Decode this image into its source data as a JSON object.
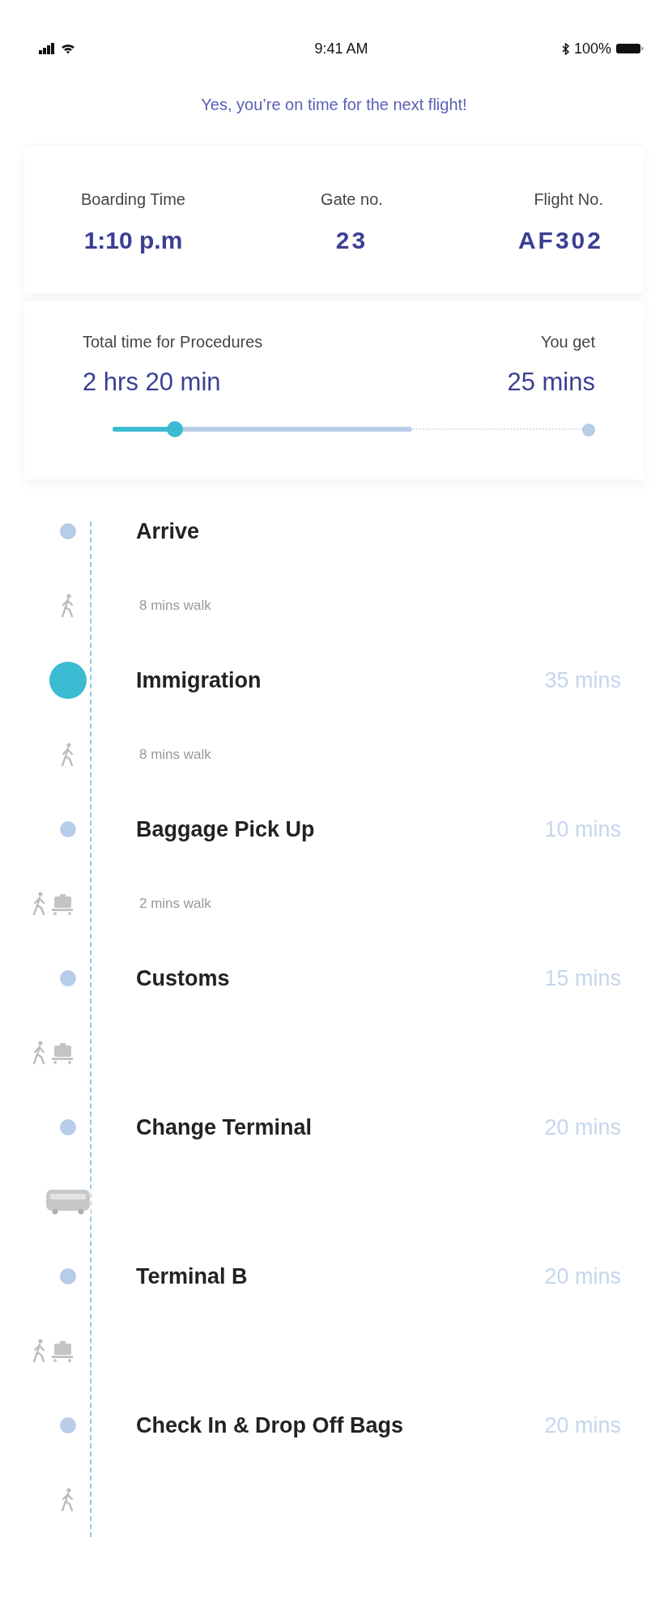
{
  "status_bar": {
    "time": "9:41 AM",
    "battery": "100%"
  },
  "banner": "Yes, you’re on time for the next flight!",
  "flight": [
    {
      "label": "Boarding Time",
      "value": "1:10 p.m"
    },
    {
      "label": "Gate no.",
      "value": "23"
    },
    {
      "label": "Flight No.",
      "value": "AF302"
    }
  ],
  "procedures": {
    "label": "Total time for Procedures",
    "value": "2 hrs 20 min",
    "spare_label": "You get",
    "spare_value": "25 mins",
    "progress": {
      "level": 0.13,
      "planned": {
        "level": 0.62
      }
    }
  },
  "timeline": [
    {
      "kind": "step",
      "title": "Arrive",
      "selected": false
    },
    {
      "kind": "walk",
      "text": "8 mins walk"
    },
    {
      "kind": "step",
      "title": "Immigration",
      "duration": "35 mins",
      "selected": true
    },
    {
      "kind": "walk",
      "text": "8 mins walk"
    },
    {
      "kind": "step",
      "title": "Baggage Pick Up",
      "duration": "10 mins",
      "selected": false
    },
    {
      "kind": "walk_cart",
      "text": "2 mins walk"
    },
    {
      "kind": "step",
      "title": "Customs",
      "duration": "15 mins",
      "selected": false
    },
    {
      "kind": "walk_cart"
    },
    {
      "kind": "step",
      "title": "Change Terminal",
      "duration": "20 mins",
      "selected": false
    },
    {
      "kind": "bus"
    },
    {
      "kind": "step",
      "title": "Terminal B",
      "duration": "20 mins",
      "selected": false
    },
    {
      "kind": "walk_cart"
    },
    {
      "kind": "step",
      "title": "Check In & Drop Off Bags",
      "duration": "20 mins",
      "selected": false
    },
    {
      "kind": "walk"
    }
  ]
}
